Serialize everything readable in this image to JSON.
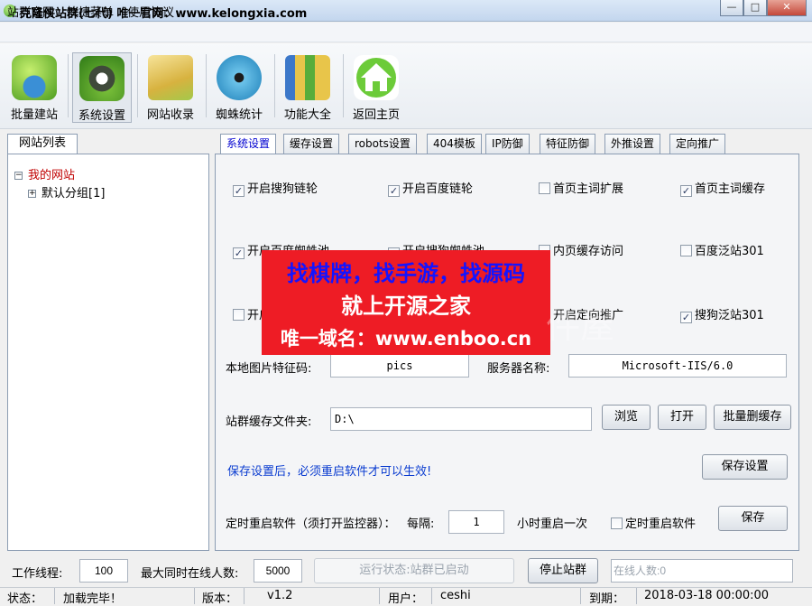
{
  "window": {
    "title": "克隆侠站群(七代)   唯一官网：www.kelongxia.com",
    "controls": {
      "minimize": "—",
      "maximize": "□",
      "close": "✕"
    }
  },
  "menu": [
    "站群官网",
    "快捷菜单",
    "使用协议"
  ],
  "toolbar": [
    {
      "label": "批量建站",
      "icon": "tree-globe-icon"
    },
    {
      "label": "系统设置",
      "icon": "gear-icon"
    },
    {
      "label": "网站收录",
      "icon": "folder-icon"
    },
    {
      "label": "蜘蛛统计",
      "icon": "spider-icon"
    },
    {
      "label": "功能大全",
      "icon": "folder-bars-icon"
    },
    {
      "label": "返回主页",
      "icon": "home-icon"
    }
  ],
  "left_panel": {
    "tab": "网站列表",
    "tree_root": "我的网站",
    "tree_root_toggle": "−",
    "tree_child": "默认分组[1]",
    "tree_child_toggle": "+"
  },
  "tabs": [
    "系统设置",
    "缓存设置",
    "robots设置",
    "404模板",
    "IP防御",
    "特征防御",
    "外推设置",
    "定向推广"
  ],
  "active_tab": 0,
  "checkboxes": [
    {
      "label": "开启搜狗链轮",
      "checked": true
    },
    {
      "label": "开启百度链轮",
      "checked": true
    },
    {
      "label": "首页主词扩展",
      "checked": false
    },
    {
      "label": "首页主词缓存",
      "checked": true
    },
    {
      "label": "开启百度蜘蛛池",
      "checked": true
    },
    {
      "label": "开启搜狗蜘蛛池",
      "checked": true
    },
    {
      "label": "内页缓存访问",
      "checked": false
    },
    {
      "label": "百度泛站301",
      "checked": false
    },
    {
      "label": "开启",
      "checked": false
    },
    {
      "label": "开启定向推广",
      "checked": false
    },
    {
      "label": "搜狗泛站301",
      "checked": true
    }
  ],
  "fields": {
    "img_feature_label": "本地图片特征码:",
    "img_feature_value": "pics",
    "server_name_label": "服务器名称:",
    "server_name_value": "Microsoft-IIS/6.0",
    "cache_folder_label": "站群缓存文件夹:",
    "cache_folder_value": "D:\\"
  },
  "buttons": {
    "browse": "浏览",
    "open": "打开",
    "batch_delete_cache": "批量删缓存",
    "save_settings": "保存设置",
    "save": "保存",
    "stop_sites": "停止站群"
  },
  "notice": "保存设置后，必须重启软件才可以生效!",
  "restart": {
    "label": "定时重启软件（须打开监控器）：",
    "interval_label": "每隔:",
    "interval_value": "1",
    "unit": "小时重启一次",
    "checkbox_label": "定时重启软件",
    "checked": false
  },
  "bottom": {
    "threads_label": "工作线程:",
    "threads_value": "100",
    "max_online_label": "最大同时在线人数:",
    "max_online_value": "5000",
    "run_status": "运行状态:站群已启动",
    "online_count": "在线人数:0"
  },
  "status": {
    "state_label": "状态：",
    "state_value": "加载完毕！",
    "version_label": "版本：",
    "version_value": "v1.2",
    "user_label": "用户：",
    "user_value": "ceshi",
    "expire_label": "到期：",
    "expire_value": "2018-03-18 00:00:00"
  },
  "overlay": {
    "line1": "找棋牌，找手游，找源码",
    "line2": "就上开源之家",
    "line3": "唯一域名：www.enboo.cn",
    "watermark": "件屋"
  },
  "colors": {
    "accent_blue": "#0a3cd0",
    "banner_red": "#ee1c25",
    "titlebar": "#c3d6ee"
  }
}
